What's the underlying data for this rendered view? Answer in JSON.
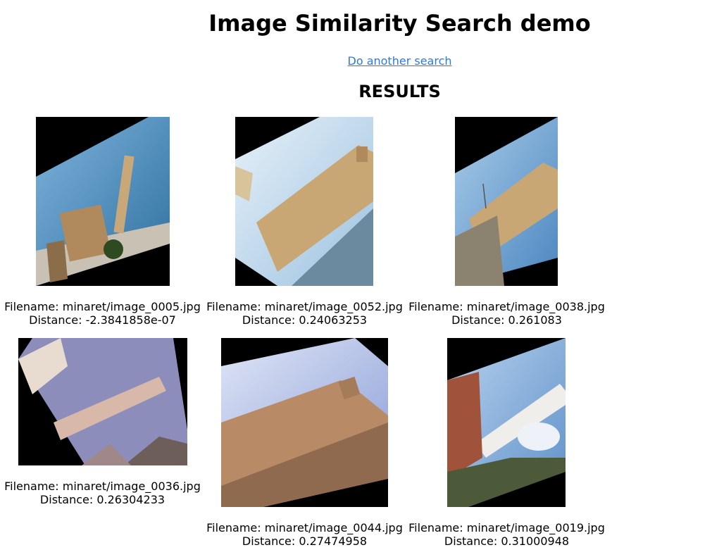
{
  "header": {
    "title": "Image Similarity Search demo",
    "another_search": "Do another search",
    "results_heading": "RESULTS"
  },
  "results": [
    {
      "filename": "Filename: minaret/image_0005.jpg",
      "distance": "Distance: -2.3841858e-07"
    },
    {
      "filename": "Filename: minaret/image_0052.jpg",
      "distance": "Distance: 0.24063253"
    },
    {
      "filename": "Filename: minaret/image_0038.jpg",
      "distance": "Distance: 0.261083"
    },
    {
      "filename": "Filename: minaret/image_0036.jpg",
      "distance": "Distance: 0.26304233"
    },
    {
      "filename": "Filename: minaret/image_0044.jpg",
      "distance": "Distance: 0.27474958"
    },
    {
      "filename": "Filename: minaret/image_0019.jpg",
      "distance": "Distance: 0.31000948"
    }
  ],
  "colors": {
    "link": "#2a7ae2",
    "thumbnail_background": "#000000"
  }
}
